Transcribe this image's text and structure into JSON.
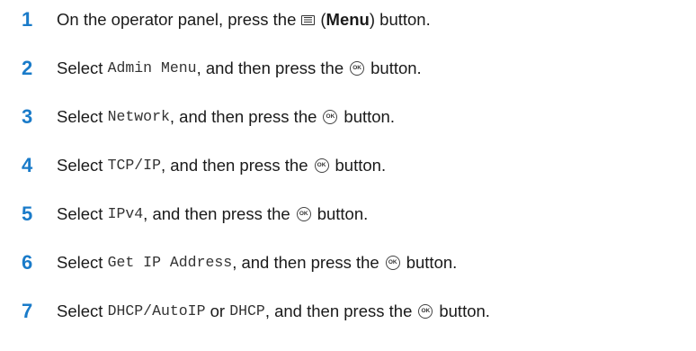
{
  "steps": [
    {
      "number": "1",
      "parts": [
        "On the operator panel, press the",
        "(",
        "Menu",
        ") button."
      ],
      "icon": "menu-icon"
    },
    {
      "number": "2",
      "parts": [
        "Select",
        "Admin Menu",
        ", and then press the",
        "button."
      ],
      "icon": "ok-button-icon"
    },
    {
      "number": "3",
      "parts": [
        "Select",
        "Network",
        ", and then press the",
        "button."
      ],
      "icon": "ok-button-icon"
    },
    {
      "number": "4",
      "parts": [
        "Select",
        "TCP/IP",
        ", and then press the",
        "button."
      ],
      "icon": "ok-button-icon"
    },
    {
      "number": "5",
      "parts": [
        "Select",
        "IPv4",
        ", and then press the",
        "button."
      ],
      "icon": "ok-button-icon"
    },
    {
      "number": "6",
      "parts": [
        "Select",
        "Get IP Address",
        ", and then press the",
        "button."
      ],
      "icon": "ok-button-icon"
    },
    {
      "number": "7",
      "parts": [
        "Select",
        "DHCP/AutoIP",
        "or",
        "DHCP",
        ", and then press the",
        "button."
      ],
      "icon": "ok-button-icon"
    }
  ],
  "ok_icon_label": "OK",
  "colors": {
    "step_number": "#1a7bc9",
    "body_text": "#1a1a1a"
  }
}
